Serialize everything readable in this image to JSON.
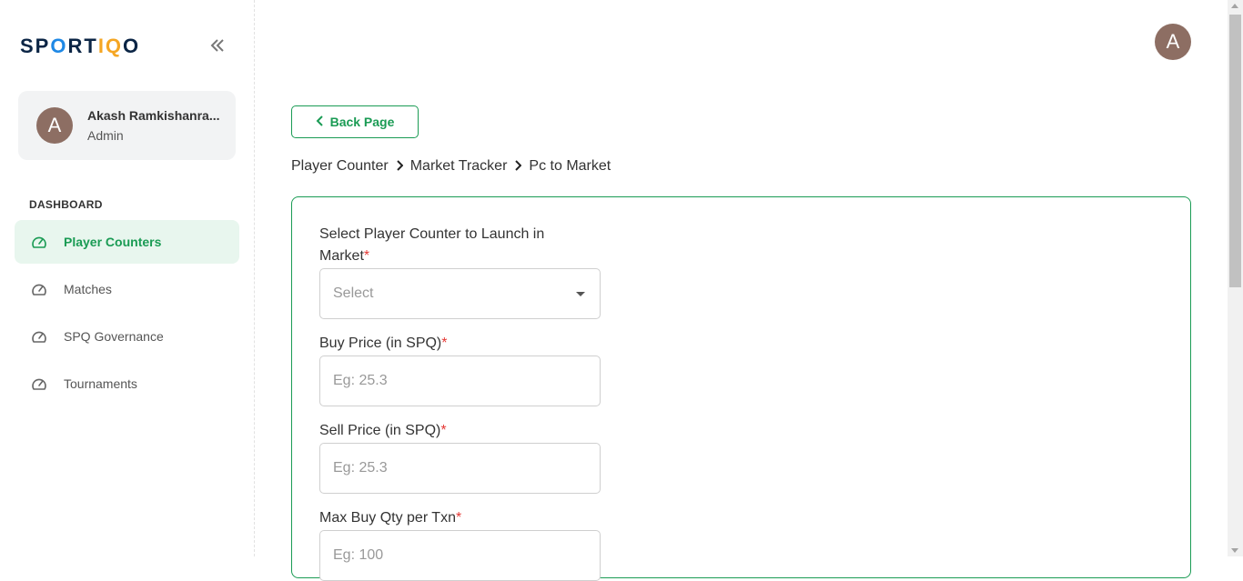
{
  "brand": {
    "logo_parts": [
      "SP",
      "O",
      "RT",
      "IQ",
      "O"
    ],
    "logo_alt": "SPORTIQO"
  },
  "sidebar": {
    "collapse_icon": "double-chevron-left-icon",
    "user": {
      "avatar_letter": "A",
      "name": "Akash Ramkishanra...",
      "role": "Admin"
    },
    "section_title": "DASHBOARD",
    "items": [
      {
        "label": "Player Counters",
        "icon": "speedometer-icon",
        "active": true
      },
      {
        "label": "Matches",
        "icon": "speedometer-icon",
        "active": false
      },
      {
        "label": "SPQ Governance",
        "icon": "speedometer-icon",
        "active": false
      },
      {
        "label": "Tournaments",
        "icon": "speedometer-icon",
        "active": false
      }
    ]
  },
  "header": {
    "avatar_letter": "A"
  },
  "back_button": {
    "label": "Back Page",
    "icon": "chevron-left-icon"
  },
  "breadcrumb": [
    "Player Counter",
    "Market Tracker",
    "Pc to Market"
  ],
  "form": {
    "fields": [
      {
        "label": "Select Player Counter to Launch in Market",
        "required_mark": "*",
        "type": "select",
        "placeholder": "Select"
      },
      {
        "label": "Buy Price (in SPQ)",
        "required_mark": "*",
        "type": "text",
        "placeholder": "Eg: 25.3"
      },
      {
        "label": "Sell Price (in SPQ)",
        "required_mark": "*",
        "type": "text",
        "placeholder": "Eg: 25.3"
      },
      {
        "label": "Max Buy Qty per Txn",
        "required_mark": "*",
        "type": "text",
        "placeholder": "Eg: 100"
      }
    ]
  },
  "colors": {
    "accent": "#1a9b54",
    "accent_bg": "#e8f6ee",
    "avatar": "#8d6e63",
    "required": "#e53935"
  }
}
